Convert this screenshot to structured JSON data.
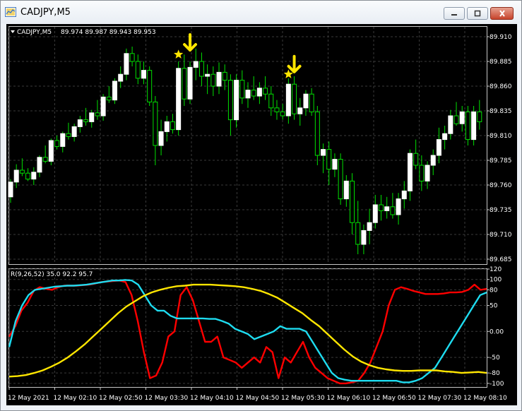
{
  "window": {
    "title": "CADJPY,M5",
    "buttons": {
      "minimize": "minimize-icon",
      "maximize": "maximize-icon",
      "close": "close-icon"
    }
  },
  "price_header": {
    "symbol": "CADJPY,M5",
    "ohlc": "89.974 89.987 89.943 89.953"
  },
  "indicator_header": "R(9,26,52) 35.0 92.2 95.7",
  "colors": {
    "background": "#000000",
    "grid": "#3a3a3a",
    "bull_candle": "#ffffff",
    "wick": "#00e000",
    "line_red": "#ff0000",
    "line_cyan": "#1edcf0",
    "line_yellow": "#ffe600",
    "marker": "#ffe600"
  },
  "x_axis_labels": [
    "12 May 2021",
    "12 May 02:10",
    "12 May 02:50",
    "12 May 03:30",
    "12 May 04:10",
    "12 May 04:50",
    "12 May 05:30",
    "12 May 06:10",
    "12 May 06:50",
    "12 May 07:30",
    "12 May 08:10"
  ],
  "chart_data": [
    {
      "type": "candlestick",
      "title": "CADJPY,M5",
      "y_ticks": [
        89.91,
        89.885,
        89.86,
        89.835,
        89.81,
        89.785,
        89.76,
        89.735,
        89.71,
        89.685
      ],
      "ylim": [
        89.68,
        89.92
      ],
      "candles": [
        [
          89.748,
          89.766,
          89.742,
          89.763
        ],
        [
          89.763,
          89.781,
          89.757,
          89.775
        ],
        [
          89.775,
          89.787,
          89.769,
          89.772
        ],
        [
          89.772,
          89.777,
          89.764,
          89.766
        ],
        [
          89.766,
          89.778,
          89.76,
          89.773
        ],
        [
          89.773,
          89.79,
          89.768,
          89.788
        ],
        [
          89.788,
          89.8,
          89.782,
          89.784
        ],
        [
          89.784,
          89.807,
          89.78,
          89.805
        ],
        [
          89.805,
          89.81,
          89.796,
          89.799
        ],
        [
          89.799,
          89.814,
          89.793,
          89.812
        ],
        [
          89.812,
          89.823,
          89.806,
          89.809
        ],
        [
          89.809,
          89.822,
          89.804,
          89.819
        ],
        [
          89.819,
          89.83,
          89.813,
          89.826
        ],
        [
          89.826,
          89.838,
          89.82,
          89.824
        ],
        [
          89.824,
          89.836,
          89.818,
          89.833
        ],
        [
          89.833,
          89.846,
          89.826,
          89.83
        ],
        [
          89.83,
          89.852,
          89.825,
          89.849
        ],
        [
          89.849,
          89.86,
          89.843,
          89.846
        ],
        [
          89.846,
          89.868,
          89.842,
          89.865
        ],
        [
          89.865,
          89.88,
          89.858,
          89.872
        ],
        [
          89.872,
          89.898,
          89.866,
          89.893
        ],
        [
          89.893,
          89.9,
          89.88,
          89.885
        ],
        [
          89.885,
          89.892,
          89.862,
          89.868
        ],
        [
          89.868,
          89.885,
          89.862,
          89.876
        ],
        [
          89.876,
          89.88,
          89.84,
          89.844
        ],
        [
          89.844,
          89.85,
          89.78,
          89.8
        ],
        [
          89.8,
          89.826,
          89.79,
          89.814
        ],
        [
          89.814,
          89.83,
          89.804,
          89.824
        ],
        [
          89.824,
          89.832,
          89.812,
          89.816
        ],
        [
          89.816,
          89.885,
          89.81,
          89.878
        ],
        [
          89.878,
          89.892,
          89.84,
          89.847
        ],
        [
          89.847,
          89.885,
          89.842,
          89.879
        ],
        [
          89.879,
          89.898,
          89.866,
          89.885
        ],
        [
          89.885,
          89.894,
          89.86,
          89.87
        ],
        [
          89.87,
          89.882,
          89.852,
          89.872
        ],
        [
          89.872,
          89.88,
          89.85,
          89.86
        ],
        [
          89.86,
          89.884,
          89.852,
          89.874
        ],
        [
          89.874,
          89.882,
          89.856,
          89.866
        ],
        [
          89.866,
          89.872,
          89.81,
          89.826
        ],
        [
          89.826,
          89.872,
          89.818,
          89.866
        ],
        [
          89.866,
          89.876,
          89.842,
          89.848
        ],
        [
          89.848,
          89.864,
          89.838,
          89.856
        ],
        [
          89.856,
          89.87,
          89.846,
          89.85
        ],
        [
          89.85,
          89.864,
          89.842,
          89.858
        ],
        [
          89.858,
          89.87,
          89.846,
          89.852
        ],
        [
          89.852,
          89.86,
          89.83,
          89.838
        ],
        [
          89.838,
          89.846,
          89.826,
          89.834
        ],
        [
          89.834,
          89.842,
          89.826,
          89.83
        ],
        [
          89.83,
          89.868,
          89.822,
          89.862
        ],
        [
          89.862,
          89.87,
          89.826,
          89.832
        ],
        [
          89.832,
          89.848,
          89.82,
          89.838
        ],
        [
          89.838,
          89.856,
          89.83,
          89.852
        ],
        [
          89.852,
          89.858,
          89.83,
          89.834
        ],
        [
          89.834,
          89.84,
          89.78,
          89.79
        ],
        [
          89.79,
          89.802,
          89.772,
          89.796
        ],
        [
          89.796,
          89.804,
          89.76,
          89.776
        ],
        [
          89.776,
          89.792,
          89.768,
          89.786
        ],
        [
          89.786,
          89.792,
          89.74,
          89.746
        ],
        [
          89.746,
          89.77,
          89.738,
          89.764
        ],
        [
          89.764,
          89.772,
          89.71,
          89.722
        ],
        [
          89.722,
          89.744,
          89.69,
          89.7
        ],
        [
          89.7,
          89.72,
          89.69,
          89.714
        ],
        [
          89.714,
          89.736,
          89.7,
          89.722
        ],
        [
          89.722,
          89.75,
          89.716,
          89.74
        ],
        [
          89.74,
          89.75,
          89.724,
          89.734
        ],
        [
          89.734,
          89.748,
          89.726,
          89.738
        ],
        [
          89.738,
          89.752,
          89.726,
          89.73
        ],
        [
          89.73,
          89.752,
          89.72,
          89.746
        ],
        [
          89.746,
          89.764,
          89.736,
          89.754
        ],
        [
          89.754,
          89.796,
          89.744,
          89.792
        ],
        [
          89.792,
          89.806,
          89.776,
          89.78
        ],
        [
          89.78,
          89.79,
          89.754,
          89.764
        ],
        [
          89.764,
          89.784,
          89.756,
          89.78
        ],
        [
          89.78,
          89.796,
          89.77,
          89.79
        ],
        [
          89.79,
          89.818,
          89.782,
          89.806
        ],
        [
          89.806,
          89.82,
          89.796,
          89.812
        ],
        [
          89.812,
          89.836,
          89.806,
          89.83
        ],
        [
          89.83,
          89.844,
          89.82,
          89.822
        ],
        [
          89.822,
          89.84,
          89.814,
          89.834
        ],
        [
          89.834,
          89.84,
          89.8,
          89.806
        ],
        [
          89.806,
          89.84,
          89.8,
          89.834
        ],
        [
          89.834,
          89.846,
          89.816,
          89.824
        ]
      ],
      "markers": [
        {
          "type": "star",
          "candle_index": 29,
          "price": 89.892
        },
        {
          "type": "arrow-down",
          "candle_index": 31,
          "price": 89.905
        },
        {
          "type": "star",
          "candle_index": 48,
          "price": 89.872
        },
        {
          "type": "arrow-down",
          "candle_index": 49,
          "price": 89.883
        }
      ]
    },
    {
      "type": "line",
      "title": "R(9,26,52)",
      "y_ticks": [
        120,
        100,
        80,
        50,
        0.0,
        -50,
        -80,
        -100
      ],
      "ylim": [
        -107,
        120
      ],
      "series": [
        {
          "name": "35.0",
          "color": "#ff0000",
          "values": [
            -10,
            10,
            40,
            55,
            78,
            85,
            82,
            80,
            85,
            88,
            88,
            88,
            89,
            90,
            92,
            95,
            96,
            97,
            98,
            95,
            70,
            20,
            -40,
            -90,
            -85,
            -60,
            -10,
            0,
            70,
            85,
            60,
            20,
            -20,
            -20,
            -10,
            -50,
            -55,
            -60,
            -70,
            -60,
            -50,
            -60,
            -30,
            -40,
            -90,
            -50,
            -60,
            -40,
            -20,
            -50,
            -70,
            -80,
            -90,
            -95,
            -100,
            -100,
            -98,
            -95,
            -80,
            -60,
            -30,
            0,
            50,
            80,
            85,
            82,
            78,
            75,
            72,
            72,
            72,
            73,
            75,
            75,
            76,
            80,
            90,
            80,
            82
          ]
        },
        {
          "name": "92.2",
          "color": "#1edcf0",
          "values": [
            -30,
            20,
            50,
            70,
            80,
            82,
            84,
            86,
            87,
            88,
            88,
            89,
            90,
            92,
            94,
            96,
            98,
            98,
            99,
            98,
            90,
            70,
            50,
            40,
            40,
            30,
            25,
            25,
            25,
            25,
            25,
            24,
            24,
            20,
            15,
            5,
            0,
            -5,
            -15,
            -10,
            -5,
            0,
            10,
            5,
            5,
            5,
            0,
            -20,
            -40,
            -60,
            -80,
            -90,
            -93,
            -95,
            -95,
            -95,
            -95,
            -95,
            -95,
            -95,
            -95,
            -98,
            -98,
            -95,
            -90,
            -80,
            -70,
            -50,
            -30,
            -10,
            10,
            30,
            50,
            70,
            75
          ]
        },
        {
          "name": "95.7",
          "color": "#ffe600",
          "values": [
            -87,
            -86,
            -84,
            -80,
            -75,
            -68,
            -60,
            -50,
            -38,
            -25,
            -10,
            5,
            20,
            35,
            48,
            58,
            68,
            75,
            80,
            84,
            87,
            88,
            90,
            90,
            90,
            89,
            88,
            87,
            85,
            82,
            78,
            72,
            65,
            55,
            45,
            35,
            22,
            10,
            -5,
            -20,
            -35,
            -48,
            -58,
            -65,
            -70,
            -73,
            -75,
            -76,
            -76,
            -75,
            -75,
            -75,
            -77,
            -78,
            -80,
            -79,
            -78,
            -80
          ]
        }
      ]
    }
  ]
}
